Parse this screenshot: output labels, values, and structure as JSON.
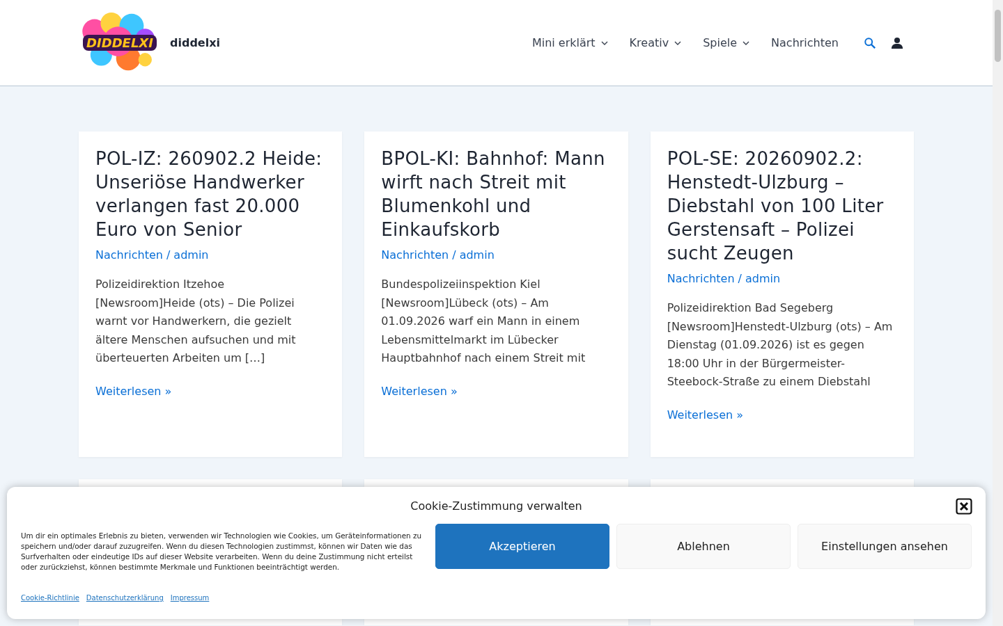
{
  "site": {
    "logo_text": "DIDDELXI",
    "name": "diddelxi"
  },
  "nav": [
    {
      "label": "Mini erklärt",
      "dropdown": true
    },
    {
      "label": "Kreativ",
      "dropdown": true
    },
    {
      "label": "Spiele",
      "dropdown": true
    },
    {
      "label": "Nachrichten",
      "dropdown": false
    }
  ],
  "posts": [
    {
      "title": "POL-IZ: 260902.2 Heide: Unseriöse Handwerker verlangen fast 20.000 Euro von Senior",
      "category": "Nachrichten",
      "separator": "/",
      "author": "admin",
      "excerpt": "Polizeidirektion Itzehoe [Newsroom]Heide (ots) – Die Polizei warnt vor Handwerkern, die gezielt ältere Menschen aufsuchen und mit überteuerten Arbeiten um […]",
      "more": "Weiterlesen »"
    },
    {
      "title": "BPOL-KI: Bahnhof: Mann wirft nach Streit mit Blumenkohl und Einkaufskorb",
      "category": "Nachrichten",
      "separator": "/",
      "author": "admin",
      "excerpt": "Bundespolizeiinspektion Kiel [Newsroom]Lübeck (ots) – Am 01.09.2026 warf ein Mann in einem Lebensmittelmarkt im Lübecker Hauptbahnhof nach einem Streit mit",
      "more": "Weiterlesen »"
    },
    {
      "title": "POL-SE: 20260902.2: Henstedt-Ulzburg – Diebstahl von 100 Liter Gerstensaft – Polizei sucht Zeugen",
      "category": "Nachrichten",
      "separator": "/",
      "author": "admin",
      "excerpt": "Polizeidirektion Bad Segeberg [Newsroom]Henstedt-Ulzburg (ots) – Am Dienstag (01.09.2026) ist es gegen 18:00 Uhr in der Bürgermeister-Steebock-Straße zu einem Diebstahl",
      "more": "Weiterlesen »"
    }
  ],
  "cookie_banner": {
    "title": "Cookie-Zustimmung verwalten",
    "text": "Um dir ein optimales Erlebnis zu bieten, verwenden wir Technologien wie Cookies, um Geräteinformationen zu speichern und/oder darauf zuzugreifen. Wenn du diesen Technologien zustimmst, können wir Daten wie das Surfverhalten oder eindeutige IDs auf dieser Website verarbeiten. Wenn du deine Zustimmung nicht erteilst oder zurückziehst, können bestimmte Merkmale und Funktionen beeinträchtigt werden.",
    "links": [
      "Cookie-Richtlinie",
      "Datenschutzerklärung",
      "Impressum"
    ],
    "buttons": [
      {
        "label": "Akzeptieren",
        "kind": "primary"
      },
      {
        "label": "Ablehnen",
        "kind": "secondary"
      },
      {
        "label": "Einstellungen ansehen",
        "kind": "secondary"
      }
    ]
  }
}
